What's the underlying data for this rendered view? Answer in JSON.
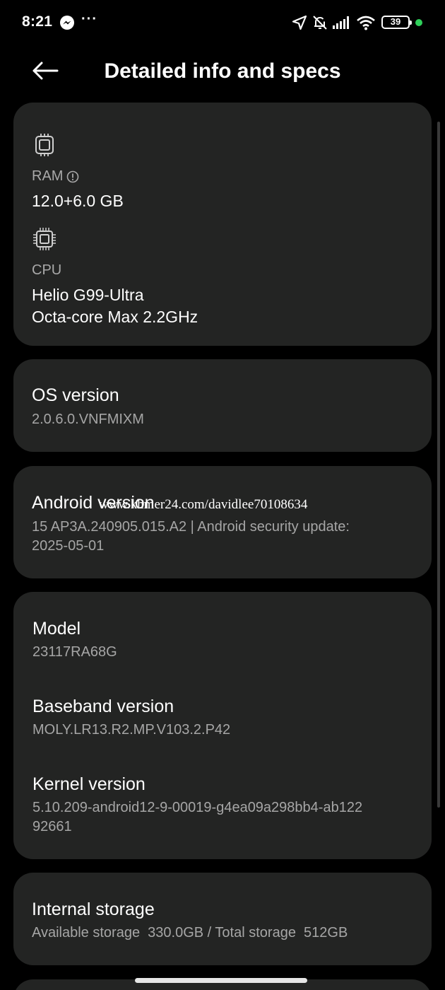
{
  "status_bar": {
    "time": "8:21",
    "more": "···",
    "battery": "39",
    "icons": [
      "messenger-icon",
      "navigation-arrow-icon",
      "bell-off-icon",
      "signal-icon",
      "wifi-icon",
      "battery-icon"
    ],
    "dot_color": "#2fd05a"
  },
  "header": {
    "title": "Detailed info and specs",
    "back_icon": "arrow-left-icon"
  },
  "hardware_card": {
    "ram_label": "RAM",
    "ram_value": "12.0+6.0 GB",
    "cpu_label": "CPU",
    "cpu_line1": "Helio G99-Ultra",
    "cpu_line2": "Octa-core Max 2.2GHz"
  },
  "os_card": {
    "title": "OS version",
    "value": "2.0.6.0.VNFMIXM"
  },
  "android_card": {
    "title": "Android version",
    "line1": "15 AP3A.240905.015.A2 | Android security update:",
    "line2": "2025-05-01"
  },
  "device_card": {
    "model_title": "Model",
    "model_value": "23117RA68G",
    "baseband_title": "Baseband version",
    "baseband_value": "MOLY.LR13.R2.MP.V103.2.P42",
    "kernel_title": "Kernel version",
    "kernel_line1": "5.10.209-android12-9-00019-g4ea09a298bb4-ab122",
    "kernel_line2": "92661"
  },
  "storage_card": {
    "title": "Internal storage",
    "value": "Available storage  330.0GB / Total storage  512GB"
  },
  "watermark": "www.khmer24.com/davidlee70108634",
  "colors": {
    "background": "#000000",
    "card": "#232423",
    "primary_text": "#ffffff",
    "secondary_text": "#a6a6a6"
  }
}
